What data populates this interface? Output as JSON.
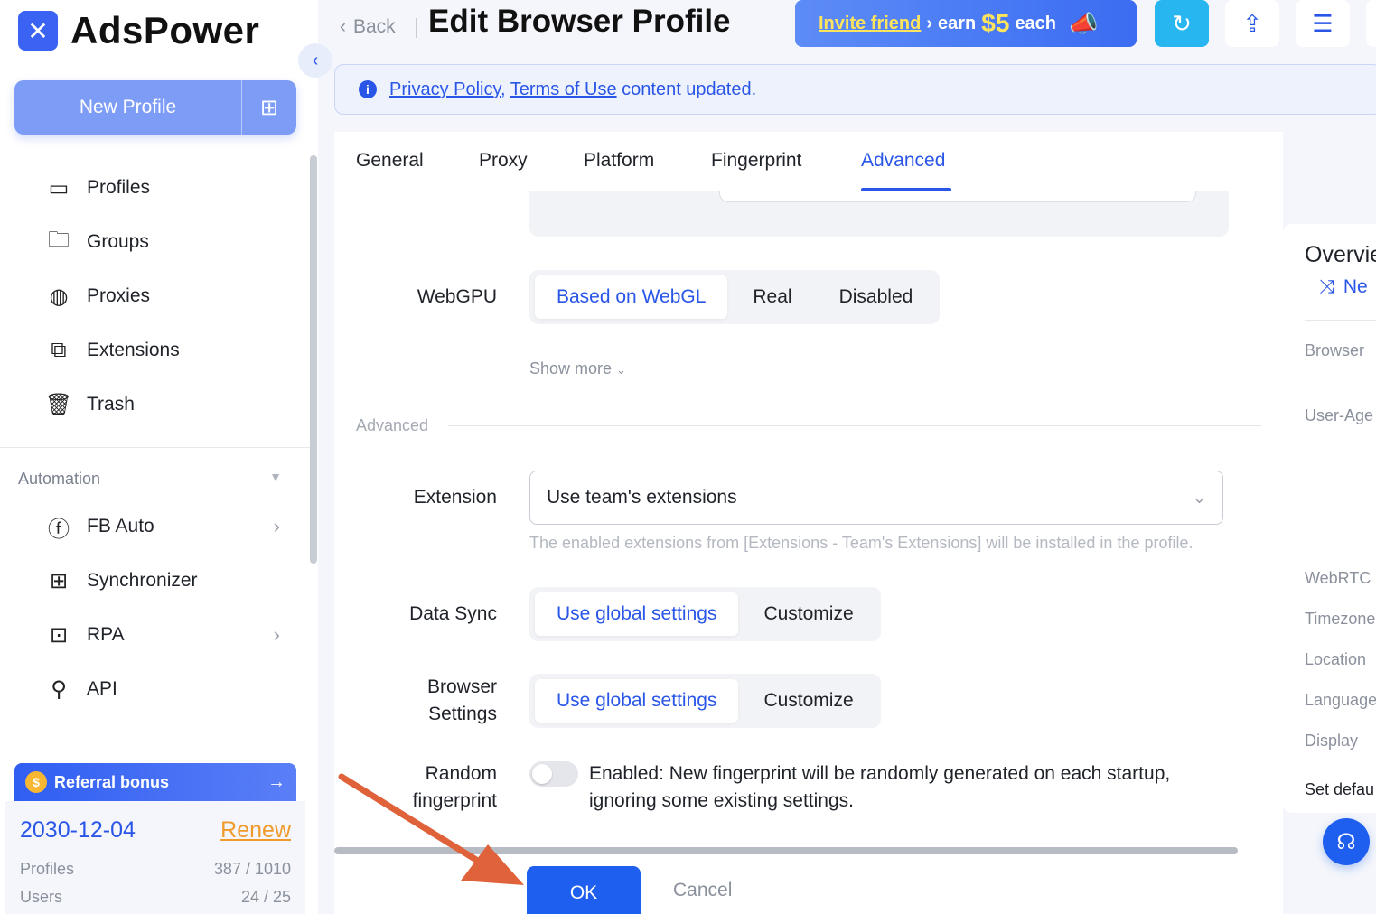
{
  "app": {
    "name": "AdsPower"
  },
  "sidebar": {
    "new_profile_label": "New Profile",
    "nav": [
      {
        "label": "Profiles",
        "icon": "window-icon"
      },
      {
        "label": "Groups",
        "icon": "folder-icon"
      },
      {
        "label": "Proxies",
        "icon": "globe-icon"
      },
      {
        "label": "Extensions",
        "icon": "puzzle-icon"
      },
      {
        "label": "Trash",
        "icon": "trash-icon"
      }
    ],
    "automation_label": "Automation",
    "automation_nav": [
      {
        "label": "FB Auto",
        "icon": "facebook-icon"
      },
      {
        "label": "Synchronizer",
        "icon": "sync-icon"
      },
      {
        "label": "RPA",
        "icon": "robot-icon"
      },
      {
        "label": "API",
        "icon": "plug-icon"
      }
    ],
    "referral_label": "Referral bonus",
    "plan": {
      "expiry": "2030-12-04",
      "renew_label": "Renew",
      "profiles_label": "Profiles",
      "profiles_value": "387 / 1010",
      "users_label": "Users",
      "users_value": "24 / 25"
    }
  },
  "header": {
    "back_label": "Back",
    "title": "Edit Browser Profile",
    "invite": {
      "friend": "Invite friend",
      "earn": "earn",
      "amount": "$5",
      "each": "each"
    }
  },
  "notice": {
    "link1": "Privacy Policy",
    "sep": ",",
    "link2": "Terms of Use",
    "text": "content updated."
  },
  "tabs": [
    "General",
    "Proxy",
    "Platform",
    "Fingerprint",
    "Advanced"
  ],
  "form": {
    "webgpu": {
      "label": "WebGPU",
      "options": [
        "Based on WebGL",
        "Real",
        "Disabled"
      ],
      "selected": "Based on WebGL"
    },
    "show_more": "Show more",
    "section": "Advanced",
    "extension": {
      "label": "Extension",
      "value": "Use team's extensions",
      "hint": "The enabled extensions from [Extensions - Team's Extensions] will be installed in the profile."
    },
    "data_sync": {
      "label": "Data Sync",
      "options": [
        "Use global settings",
        "Customize"
      ],
      "selected": "Use global settings"
    },
    "browser_settings": {
      "label_line1": "Browser",
      "label_line2": "Settings",
      "options": [
        "Use global settings",
        "Customize"
      ],
      "selected": "Use global settings"
    },
    "random_fp": {
      "label_line1": "Random",
      "label_line2": "fingerprint",
      "enabled": false,
      "text_line1": "Enabled: New fingerprint will be randomly generated on each startup,",
      "text_line2": "ignoring some existing settings."
    },
    "ok_label": "OK",
    "cancel_label": "Cancel"
  },
  "overview": {
    "title": "Overvie",
    "new_label": "Ne",
    "items": [
      "Browser",
      "User-Age",
      "WebRTC",
      "Timezone",
      "Location",
      "Language",
      "Display",
      "Set defau"
    ]
  },
  "colors": {
    "accent": "#2a56e8",
    "ok_button": "#1f5ff0",
    "annotation_arrow": "#e0623a"
  }
}
